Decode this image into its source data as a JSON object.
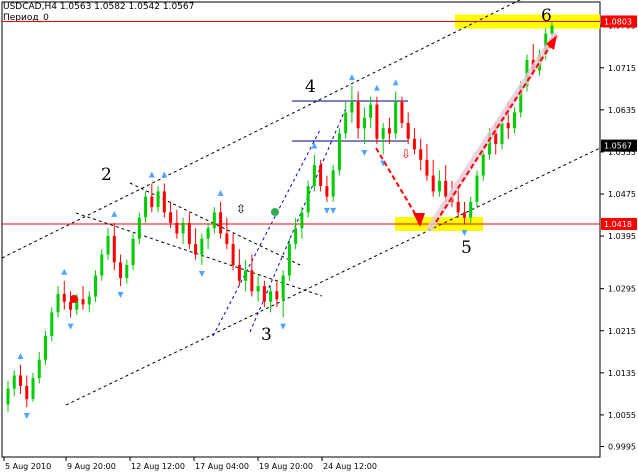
{
  "header": {
    "symbol_line": "USDCAD,H4  1.0563 1.0582 1.0542 1.0567",
    "period_line": "Период_0"
  },
  "chart_data": {
    "type": "candlestick",
    "symbol": "USDCAD",
    "timeframe": "H4",
    "ohlc_last": {
      "open": 1.0563,
      "high": 1.0582,
      "low": 1.0542,
      "close": 1.0567
    },
    "ylim": [
      0.9975,
      1.084
    ],
    "y_ticks": [
      1.0795,
      1.0715,
      1.0635,
      1.0555,
      1.0475,
      1.0395,
      1.0295,
      1.0215,
      1.0135,
      1.0055,
      0.9995
    ],
    "y_tick_labels": [
      "1.0795",
      "1.0715",
      "1.0635",
      "1.0555",
      "1.0475",
      "1.0395",
      "1.0295",
      "1.0215",
      "1.0135",
      "1.0055",
      "0.9995"
    ],
    "x_tick_labels": [
      "5 Aug 2010",
      "9 Aug 20:00",
      "12 Aug 12:00",
      "17 Aug 04:00",
      "19 Aug 20:00",
      "24 Aug 12:00"
    ],
    "price_tags": [
      {
        "label": "1.0803",
        "value": 1.0803,
        "color": "#ff0000"
      },
      {
        "label": "1.0567",
        "value": 1.0567,
        "color": "#000000"
      },
      {
        "label": "1.0418",
        "value": 1.0418,
        "color": "#ff0000"
      }
    ],
    "horizontal_levels": [
      {
        "value": 1.0803,
        "color": "#ff0000"
      },
      {
        "value": 1.0418,
        "color": "#ff0000"
      }
    ],
    "wave_labels": [
      "2",
      "3",
      "4",
      "5",
      "6"
    ],
    "colors": {
      "bull": "#00cc00",
      "bear": "#ff0000",
      "level": "#ff0000",
      "target_zone": "#ffff00",
      "channel": "#000000",
      "wedge": "#0000cc",
      "fractal": "#4da6ff"
    },
    "candles": [
      [
        1.0075,
        1.012,
        1.006,
        1.0105
      ],
      [
        1.0105,
        1.014,
        1.009,
        1.013
      ],
      [
        1.013,
        1.015,
        1.0095,
        1.011
      ],
      [
        1.011,
        1.013,
        1.007,
        1.0085
      ],
      [
        1.0085,
        1.0135,
        1.008,
        1.0125
      ],
      [
        1.0125,
        1.0175,
        1.0115,
        1.016
      ],
      [
        1.016,
        1.0215,
        1.015,
        1.0205
      ],
      [
        1.0205,
        1.026,
        1.0195,
        1.025
      ],
      [
        1.025,
        1.03,
        1.024,
        1.0285
      ],
      [
        1.0285,
        1.031,
        1.0255,
        1.027
      ],
      [
        1.027,
        1.029,
        1.024,
        1.0255
      ],
      [
        1.0255,
        1.0285,
        1.0245,
        1.0275
      ],
      [
        1.0275,
        1.03,
        1.0255,
        1.0265
      ],
      [
        1.0265,
        1.029,
        1.025,
        1.028
      ],
      [
        1.028,
        1.033,
        1.027,
        1.032
      ],
      [
        1.032,
        1.037,
        1.031,
        1.036
      ],
      [
        1.036,
        1.041,
        1.035,
        1.0395
      ],
      [
        1.0395,
        1.042,
        1.033,
        1.0345
      ],
      [
        1.0345,
        1.036,
        1.03,
        1.0315
      ],
      [
        1.0315,
        1.035,
        1.0305,
        1.034
      ],
      [
        1.034,
        1.04,
        1.033,
        1.039
      ],
      [
        1.039,
        1.044,
        1.038,
        1.043
      ],
      [
        1.043,
        1.048,
        1.042,
        1.047
      ],
      [
        1.047,
        1.0495,
        1.044,
        1.045
      ],
      [
        1.045,
        1.049,
        1.044,
        1.048
      ],
      [
        1.048,
        1.0495,
        1.043,
        1.044
      ],
      [
        1.044,
        1.046,
        1.041,
        1.042
      ],
      [
        1.042,
        1.0445,
        1.039,
        1.04
      ],
      [
        1.04,
        1.043,
        1.038,
        1.042
      ],
      [
        1.042,
        1.044,
        1.037,
        1.038
      ],
      [
        1.038,
        1.041,
        1.035,
        1.036
      ],
      [
        1.036,
        1.04,
        1.034,
        1.039
      ],
      [
        1.039,
        1.042,
        1.037,
        1.041
      ],
      [
        1.041,
        1.045,
        1.04,
        1.044
      ],
      [
        1.044,
        1.046,
        1.039,
        1.04
      ],
      [
        1.04,
        1.043,
        1.037,
        1.038
      ],
      [
        1.038,
        1.04,
        1.033,
        1.034
      ],
      [
        1.034,
        1.037,
        1.03,
        1.031
      ],
      [
        1.031,
        1.035,
        1.029,
        1.033
      ],
      [
        1.033,
        1.036,
        1.028,
        1.029
      ],
      [
        1.029,
        1.032,
        1.027,
        1.03
      ],
      [
        1.03,
        1.031,
        1.026,
        1.027
      ],
      [
        1.027,
        1.03,
        1.025,
        1.029
      ],
      [
        1.029,
        1.031,
        1.026,
        1.0275
      ],
      [
        1.0275,
        1.033,
        1.024,
        1.032
      ],
      [
        1.032,
        1.039,
        1.031,
        1.038
      ],
      [
        1.038,
        1.043,
        1.037,
        1.041
      ],
      [
        1.041,
        1.045,
        1.039,
        1.044
      ],
      [
        1.044,
        1.05,
        1.043,
        1.049
      ],
      [
        1.049,
        1.055,
        1.048,
        1.053
      ],
      [
        1.053,
        1.054,
        1.048,
        1.049
      ],
      [
        1.049,
        1.051,
        1.046,
        1.047
      ],
      [
        1.047,
        1.053,
        1.046,
        1.052
      ],
      [
        1.052,
        1.06,
        1.051,
        1.059
      ],
      [
        1.059,
        1.065,
        1.058,
        1.063
      ],
      [
        1.063,
        1.068,
        1.061,
        1.065
      ],
      [
        1.065,
        1.067,
        1.058,
        1.06
      ],
      [
        1.06,
        1.064,
        1.057,
        1.062
      ],
      [
        1.062,
        1.066,
        1.06,
        1.0645
      ],
      [
        1.0645,
        1.066,
        1.057,
        1.058
      ],
      [
        1.058,
        1.061,
        1.055,
        1.06
      ],
      [
        1.06,
        1.062,
        1.057,
        1.059
      ],
      [
        1.059,
        1.067,
        1.058,
        1.065
      ],
      [
        1.065,
        1.066,
        1.06,
        1.061
      ],
      [
        1.061,
        1.063,
        1.057,
        1.058
      ],
      [
        1.058,
        1.06,
        1.055,
        1.056
      ],
      [
        1.056,
        1.058,
        1.052,
        1.054
      ],
      [
        1.054,
        1.057,
        1.05,
        1.051
      ],
      [
        1.051,
        1.054,
        1.047,
        1.048
      ],
      [
        1.048,
        1.052,
        1.047,
        1.05
      ],
      [
        1.05,
        1.053,
        1.046,
        1.047
      ],
      [
        1.047,
        1.05,
        1.045,
        1.046
      ],
      [
        1.046,
        1.049,
        1.043,
        1.044
      ],
      [
        1.044,
        1.046,
        1.0418,
        1.043
      ],
      [
        1.043,
        1.047,
        1.042,
        1.046
      ],
      [
        1.046,
        1.052,
        1.045,
        1.051
      ],
      [
        1.051,
        1.056,
        1.05,
        1.055
      ],
      [
        1.055,
        1.06,
        1.054,
        1.059
      ],
      [
        1.059,
        1.061,
        1.055,
        1.057
      ],
      [
        1.057,
        1.062,
        1.056,
        1.061
      ],
      [
        1.061,
        1.065,
        1.058,
        1.06
      ],
      [
        1.06,
        1.064,
        1.059,
        1.063
      ],
      [
        1.063,
        1.069,
        1.062,
        1.068
      ],
      [
        1.068,
        1.074,
        1.067,
        1.073
      ],
      [
        1.073,
        1.076,
        1.07,
        1.071
      ],
      [
        1.071,
        1.075,
        1.07,
        1.074
      ],
      [
        1.074,
        1.079,
        1.073,
        1.078
      ],
      [
        1.078,
        1.0803,
        1.076,
        1.0795
      ]
    ]
  }
}
